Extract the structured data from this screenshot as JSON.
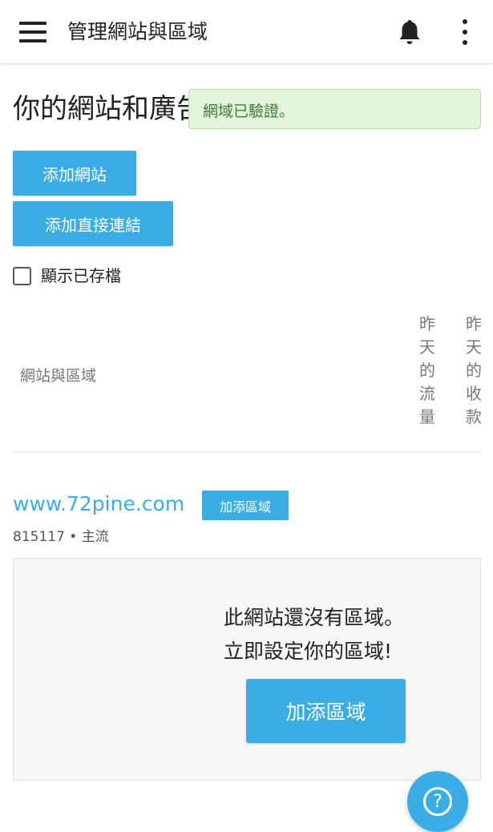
{
  "app_bar": {
    "title": "管理網站與區域",
    "menu_icon": "hamburger-menu-icon",
    "bell_icon": "bell-icon",
    "more_icon": "more-vertical-icon"
  },
  "page": {
    "heading": "你的網站和廣告",
    "toast": "網域已驗證。"
  },
  "actions": {
    "add_site": "添加網站",
    "add_direct_link": "添加直接連結"
  },
  "filters": {
    "show_archived_label": "顯示已存檔",
    "show_archived_checked": false
  },
  "table": {
    "col_sites": "網站與區域",
    "col_traffic": [
      "昨",
      "天",
      "的",
      "流",
      "量"
    ],
    "col_revenue": [
      "昨",
      "天",
      "的",
      "收",
      "款"
    ]
  },
  "site": {
    "domain": "www.72pine.com",
    "add_zone_badge": "加添區域",
    "meta": "815117 • 主流"
  },
  "zones_empty": {
    "line1": "此網站還沒有區域。",
    "line2": "立即設定你的區域!",
    "button": "加添區域"
  },
  "help": {
    "icon": "help-question-icon",
    "glyph": "?"
  },
  "colors": {
    "accent": "#3aaee4",
    "toast_bg": "#e3f4dd",
    "toast_text": "#3d7a33",
    "panel_bg": "#f6f6f6"
  }
}
